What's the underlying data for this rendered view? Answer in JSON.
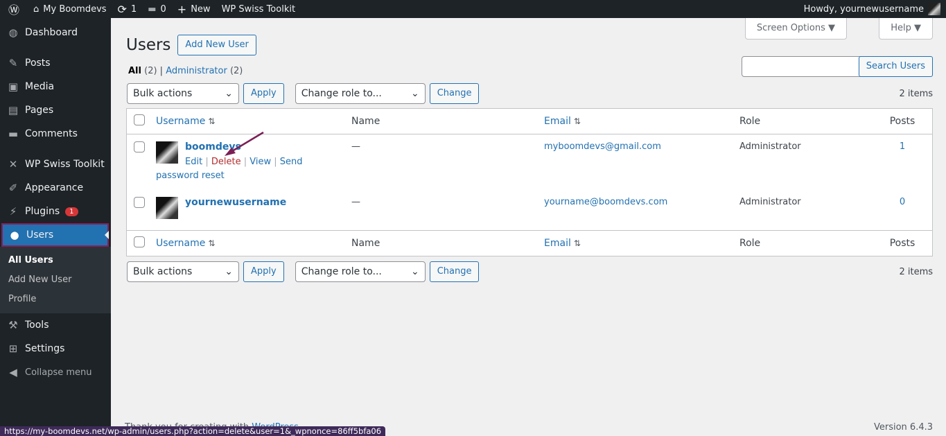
{
  "adminbar": {
    "site": "My Boomdevs",
    "updates": "1",
    "comments": "0",
    "new": "New",
    "plugin": "WP Swiss Toolkit",
    "howdy": "Howdy, yournewusername"
  },
  "menu": [
    {
      "label": "Dashboard",
      "icon": "dashboard-icon",
      "glyph": "◍"
    },
    {
      "label": "Posts",
      "icon": "pin-icon",
      "glyph": "✎"
    },
    {
      "label": "Media",
      "icon": "media-icon",
      "glyph": "▣"
    },
    {
      "label": "Pages",
      "icon": "pages-icon",
      "glyph": "▤"
    },
    {
      "label": "Comments",
      "icon": "comment-icon",
      "glyph": "▬"
    },
    {
      "label": "WP Swiss Toolkit",
      "icon": "tools-cross-icon",
      "glyph": "✕"
    },
    {
      "label": "Appearance",
      "icon": "brush-icon",
      "glyph": "✐"
    },
    {
      "label": "Plugins",
      "icon": "plugin-icon",
      "glyph": "⚡",
      "badge": "1"
    },
    {
      "label": "Users",
      "icon": "user-icon",
      "glyph": "●"
    },
    {
      "label": "Tools",
      "icon": "wrench-icon",
      "glyph": "⚒"
    },
    {
      "label": "Settings",
      "icon": "settings-icon",
      "glyph": "⊞"
    },
    {
      "label": "Collapse menu",
      "icon": "collapse-icon",
      "glyph": "◀"
    }
  ],
  "submenu": [
    "All Users",
    "Add New User",
    "Profile"
  ],
  "page": {
    "title": "Users",
    "add_new": "Add New User",
    "screen_options": "Screen Options ▼",
    "help": "Help ▼",
    "filter_all": "All",
    "filter_all_count": "(2)",
    "filter_admin": "Administrator",
    "filter_admin_count": "(2)",
    "search_button": "Search Users",
    "search_value": "",
    "bulk": "Bulk actions",
    "apply": "Apply",
    "change_role": "Change role to...",
    "change": "Change",
    "items": "2 items"
  },
  "table": {
    "columns": [
      "Username",
      "Name",
      "Email",
      "Role",
      "Posts"
    ],
    "rows": [
      {
        "username": "boomdevs",
        "name": "—",
        "email": "myboomdevs@gmail.com",
        "role": "Administrator",
        "posts": "1",
        "actions": {
          "edit": "Edit",
          "delete": "Delete",
          "view": "View",
          "reset": "Send password reset"
        }
      },
      {
        "username": "yournewusername",
        "name": "—",
        "email": "yourname@boomdevs.com",
        "role": "Administrator",
        "posts": "0"
      }
    ]
  },
  "footer": {
    "thanks": "Thank you for creating with ",
    "wp": "WordPress",
    "version": "Version 6.4.3"
  },
  "statusbar": "https://my-boomdevs.net/wp-admin/users.php?action=delete&user=1&_wpnonce=86ff5bfa06",
  "colors": {
    "accent": "#2271b1",
    "delete": "#b32d2e",
    "arrow": "#7b1f55"
  }
}
